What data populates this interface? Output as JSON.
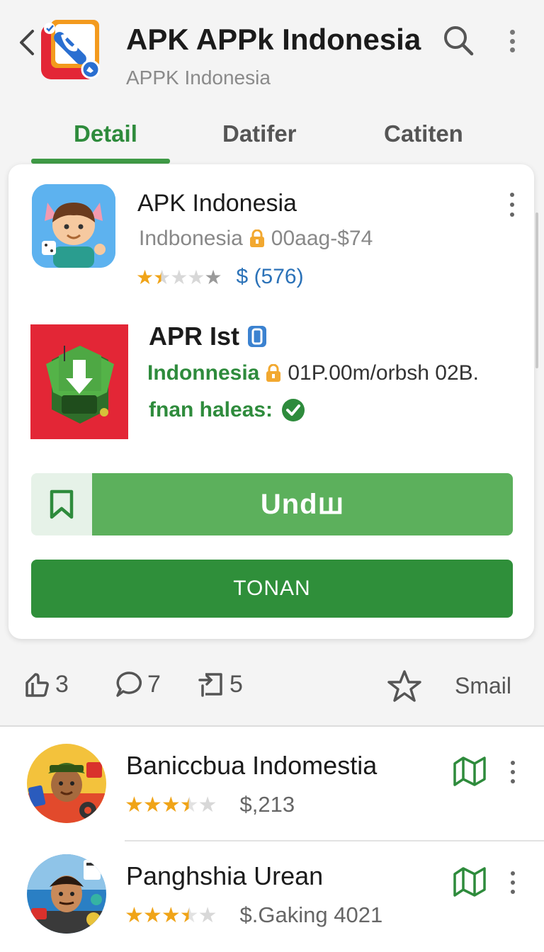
{
  "header": {
    "title": "APK APPk Indonesia",
    "subtitle": "APPK Indonesia",
    "back_icon": "chevron-left-icon",
    "search_icon": "search-icon",
    "more_icon": "more-vert-icon"
  },
  "tabs": [
    {
      "label": "Detail",
      "active": true
    },
    {
      "label": "Datifer",
      "active": false
    },
    {
      "label": "Catiten",
      "active": false
    }
  ],
  "card": {
    "item1": {
      "title": "APK Indonesia",
      "region": "Indbonesia",
      "price_info": "00aag-$74",
      "rating_stars": 1.5,
      "rating_price": "$ (576)"
    },
    "item2": {
      "title": "APR Ist",
      "country": "Indonnesia",
      "size": "01P.00m/orbsh 02B.",
      "status": "fnan haleas:"
    },
    "download_label": "Undꟺ",
    "install_label": "TONAN"
  },
  "actions": {
    "likes": "3",
    "comments": "7",
    "shares": "5",
    "smail_label": "Smail"
  },
  "list": [
    {
      "title": "Banicсbua Indomestia",
      "rating_stars": 3.5,
      "price": "$,213"
    },
    {
      "title": "Panghshia Urean",
      "rating_stars": 3.5,
      "price": "$.Gaking 4021"
    }
  ],
  "colors": {
    "accent_green": "#2e8b3c",
    "button_green": "#5cb05c",
    "install_green": "#2f8f3a",
    "star_gold": "#f0a418",
    "link_blue": "#2b72b8"
  }
}
